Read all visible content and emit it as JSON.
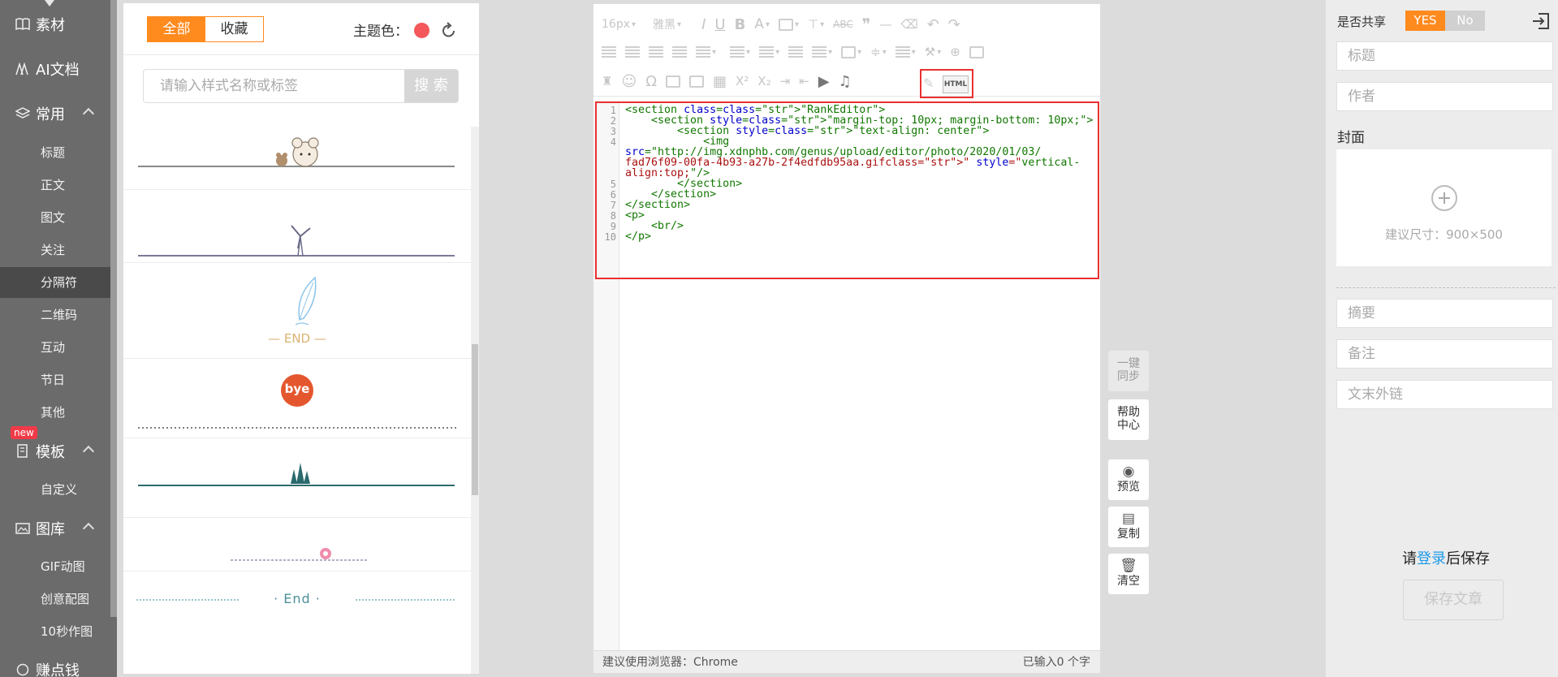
{
  "nav": {
    "sections": [
      {
        "label": "素材",
        "icon": "book-icon"
      },
      {
        "label": "AI文档",
        "icon": "ai-icon"
      },
      {
        "label": "常用",
        "icon": "layers-icon"
      },
      {
        "label": "模板",
        "icon": "template-icon"
      },
      {
        "label": "图库",
        "icon": "image-icon"
      },
      {
        "label": "赚点钱",
        "icon": "money-icon"
      }
    ],
    "common_items": [
      "标题",
      "正文",
      "图文",
      "关注",
      "分隔符",
      "二维码",
      "互动",
      "节日",
      "其他"
    ],
    "active_item": "分隔符",
    "template_items": [
      "自定义"
    ],
    "gallery_items": [
      "GIF动图",
      "创意配图",
      "10秒作图"
    ],
    "new_badge": "new"
  },
  "library": {
    "tabs": [
      "全部",
      "收藏"
    ],
    "active_tab": "全部",
    "theme_label": "主题色：",
    "theme_color": "#f4585a",
    "search_placeholder": "请输入样式名称或标签",
    "search_button": "搜 索",
    "tiles": {
      "end_text_1": "— END —",
      "bye_text": "bye",
      "end_text_2": "·   End   ·"
    }
  },
  "editor": {
    "toolbar": {
      "font_size": "16px",
      "font_family": "雅黑",
      "html_button": "HTML"
    },
    "code_lines": [
      {
        "n": "1",
        "t": "<section class=\"RankEditor\">"
      },
      {
        "n": "2",
        "t": "    <section style=\"margin-top: 10px; margin-bottom: 10px;\">"
      },
      {
        "n": "3",
        "t": "        <section style=\"text-align: center\">"
      },
      {
        "n": "4",
        "t": "            <img"
      },
      {
        "n": "",
        "t": "src=\"http://img.xdnphb.com/genus/upload/editor/photo/2020/01/03/"
      },
      {
        "n": "",
        "t": "fad76f09-00fa-4b93-a27b-2f4edfdb95aa.gif\" style=\"vertical-"
      },
      {
        "n": "",
        "t": "align:top;\"/>"
      },
      {
        "n": "5",
        "t": "        </section>"
      },
      {
        "n": "6",
        "t": "    </section>"
      },
      {
        "n": "7",
        "t": "</section>"
      },
      {
        "n": "8",
        "t": "<p>"
      },
      {
        "n": "9",
        "t": "    <br/>"
      },
      {
        "n": "10",
        "t": "</p>"
      }
    ],
    "status_left": "建议使用浏览器：Chrome",
    "status_right": "已输入0 个字"
  },
  "actions": {
    "sync": "一键\n同步",
    "help": "帮助\n中心",
    "preview": "预览",
    "copy": "复制",
    "clear": "清空"
  },
  "meta": {
    "share_label": "是否共享",
    "yes": "YES",
    "no": "No",
    "title_placeholder": "标题",
    "author_placeholder": "作者",
    "cover_label": "封面",
    "cover_hint": "建议尺寸：900×500",
    "summary_placeholder": "摘要",
    "note_placeholder": "备注",
    "link_placeholder": "文末外链",
    "login_pre": "请",
    "login_link": "登录",
    "login_post": "后保存",
    "save_button": "保存文章"
  }
}
